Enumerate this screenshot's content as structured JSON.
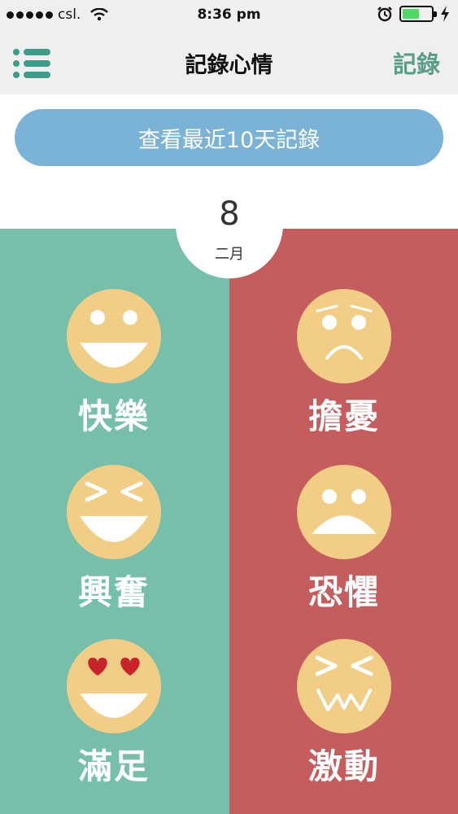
{
  "status_bar": {
    "carrier": "csl.",
    "time": "8:36 pm",
    "battery_percent": 60
  },
  "nav": {
    "title": "記錄心情",
    "action": "記錄"
  },
  "recent_button": {
    "label": "查看最近10天記錄"
  },
  "date": {
    "day": "8",
    "month": "二月"
  },
  "colors": {
    "positive_panel": "#76c0ab",
    "negative_panel": "#c55c5e",
    "face": "#f2cd85",
    "accent": "#3d9d8a"
  },
  "emotions": {
    "positive": [
      {
        "label": "快樂",
        "icon": "happy-face-icon"
      },
      {
        "label": "興奮",
        "icon": "excited-face-icon"
      },
      {
        "label": "滿足",
        "icon": "heart-eyes-face-icon"
      }
    ],
    "negative": [
      {
        "label": "擔憂",
        "icon": "worried-face-icon"
      },
      {
        "label": "恐懼",
        "icon": "fear-face-icon"
      },
      {
        "label": "激動",
        "icon": "agitated-face-icon"
      }
    ]
  }
}
